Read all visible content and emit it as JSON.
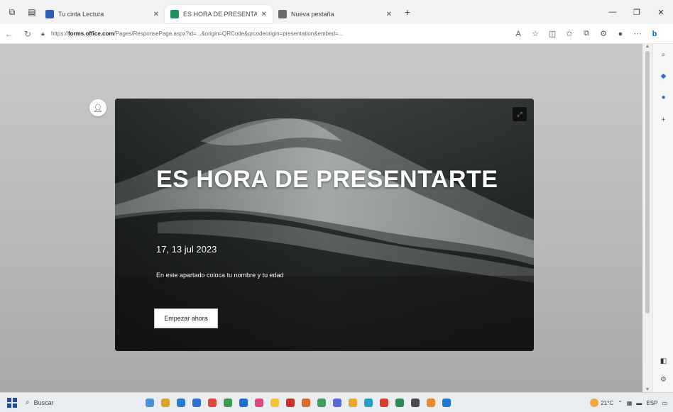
{
  "browser": {
    "tabs": [
      {
        "title": "Tu cinta Lectura",
        "favicon_color": "#2b5fb4",
        "active": false
      },
      {
        "title": "ES HORA DE PRESENTARTE",
        "favicon_color": "#1f8f5f",
        "active": true
      },
      {
        "title": "Nueva pestaña",
        "favicon_color": "#6a6a6a",
        "active": false
      }
    ],
    "new_tab_label": "+",
    "url_prefix": "https://",
    "url_domain": "forms.office.com",
    "url_rest": "/Pages/ResponsePage.aspx?id=...&origin=QRCode&qrcodeorigin=presentation&embed=..."
  },
  "form_card": {
    "title": "ES HORA DE PRESENTARTE",
    "date": "17, 13 jul 2023",
    "description": "En este apartado coloca tu nombre y tu edad",
    "start_button": "Empezar ahora"
  },
  "taskbar": {
    "search_placeholder": "Buscar",
    "weather_temp": "21°C",
    "tray_lang": "ESP",
    "app_colors": [
      "#4a90d9",
      "#e0a030",
      "#2d7ad6",
      "#2f6fd1",
      "#e04a3c",
      "#3c9a4a",
      "#1e6fc7",
      "#d94a7a",
      "#f5c33b",
      "#c8322a",
      "#e06a2a",
      "#3fa05a",
      "#5a6bd6",
      "#e7a62e",
      "#2aa0c9",
      "#d23f31",
      "#2e8a55",
      "#4a4a4a",
      "#e98b2c",
      "#1f78d1"
    ]
  },
  "colors": {
    "card_bg": "#1d1f20",
    "page_bg": "#c4c4c4",
    "accent": "#0f6cbd"
  }
}
